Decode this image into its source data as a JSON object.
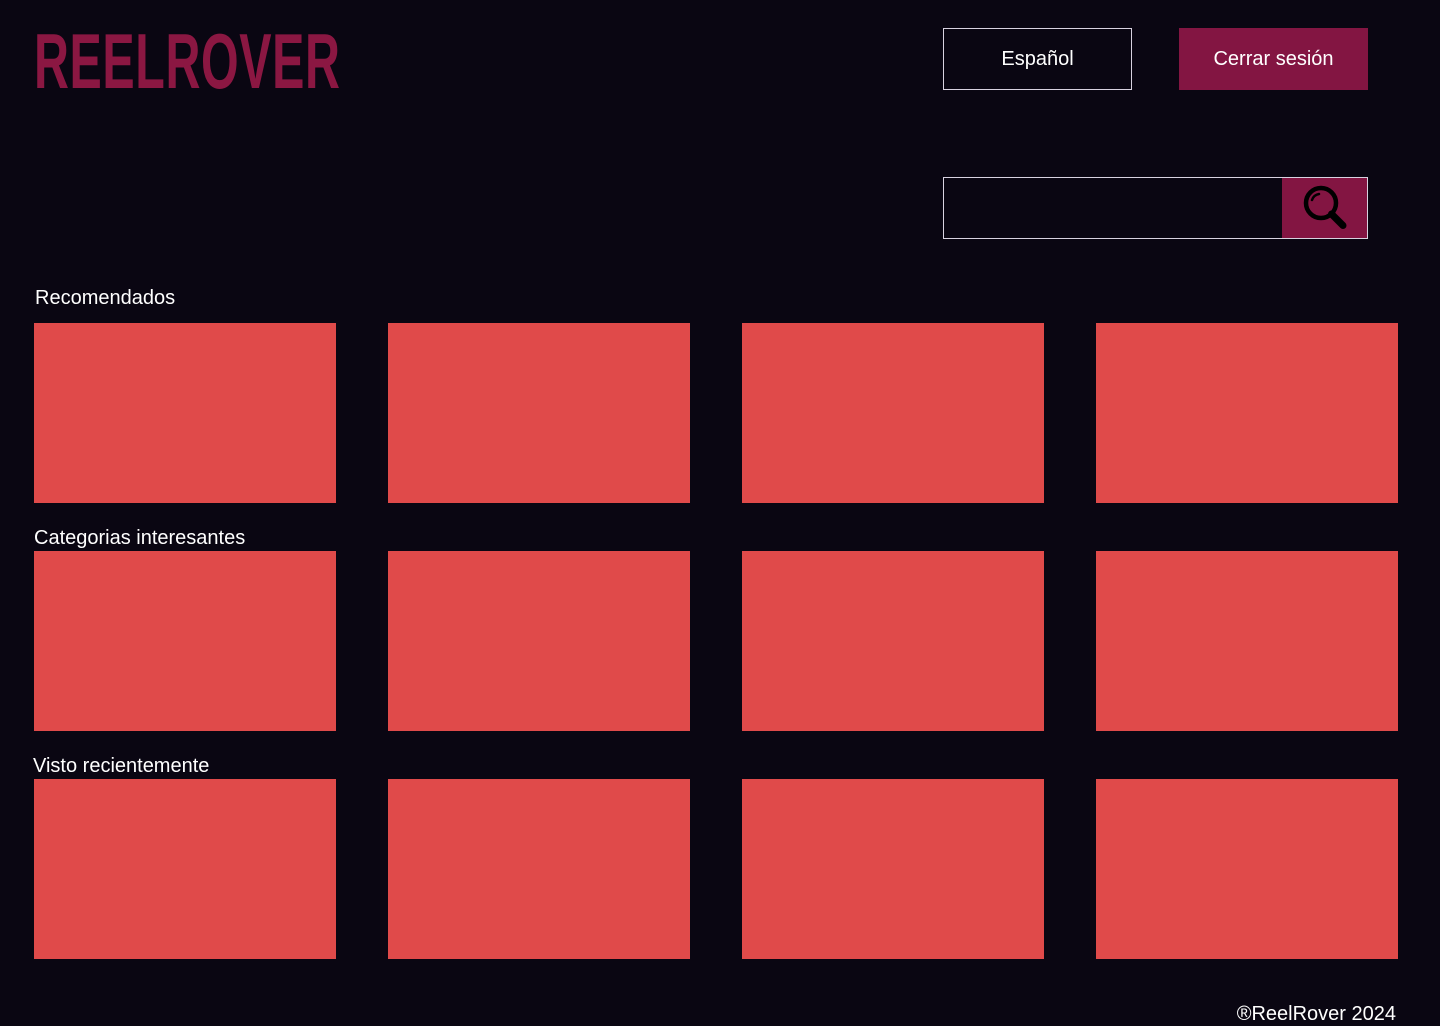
{
  "header": {
    "logo_text": "REELROVER",
    "language_label": "Español",
    "logout_label": "Cerrar sesión"
  },
  "search": {
    "value": "",
    "placeholder": "",
    "button_icon": "search-icon"
  },
  "sections": [
    {
      "title": "Recomendados",
      "item_count": 4
    },
    {
      "title": "Categorias interesantes",
      "item_count": 4
    },
    {
      "title": "Visto recientemente",
      "item_count": 4
    }
  ],
  "footer": {
    "copyright": "®ReelRover 2024"
  },
  "colors": {
    "background": "#0a0612",
    "brand": "#831542",
    "card": "#e04a4a",
    "text": "#ffffff"
  }
}
